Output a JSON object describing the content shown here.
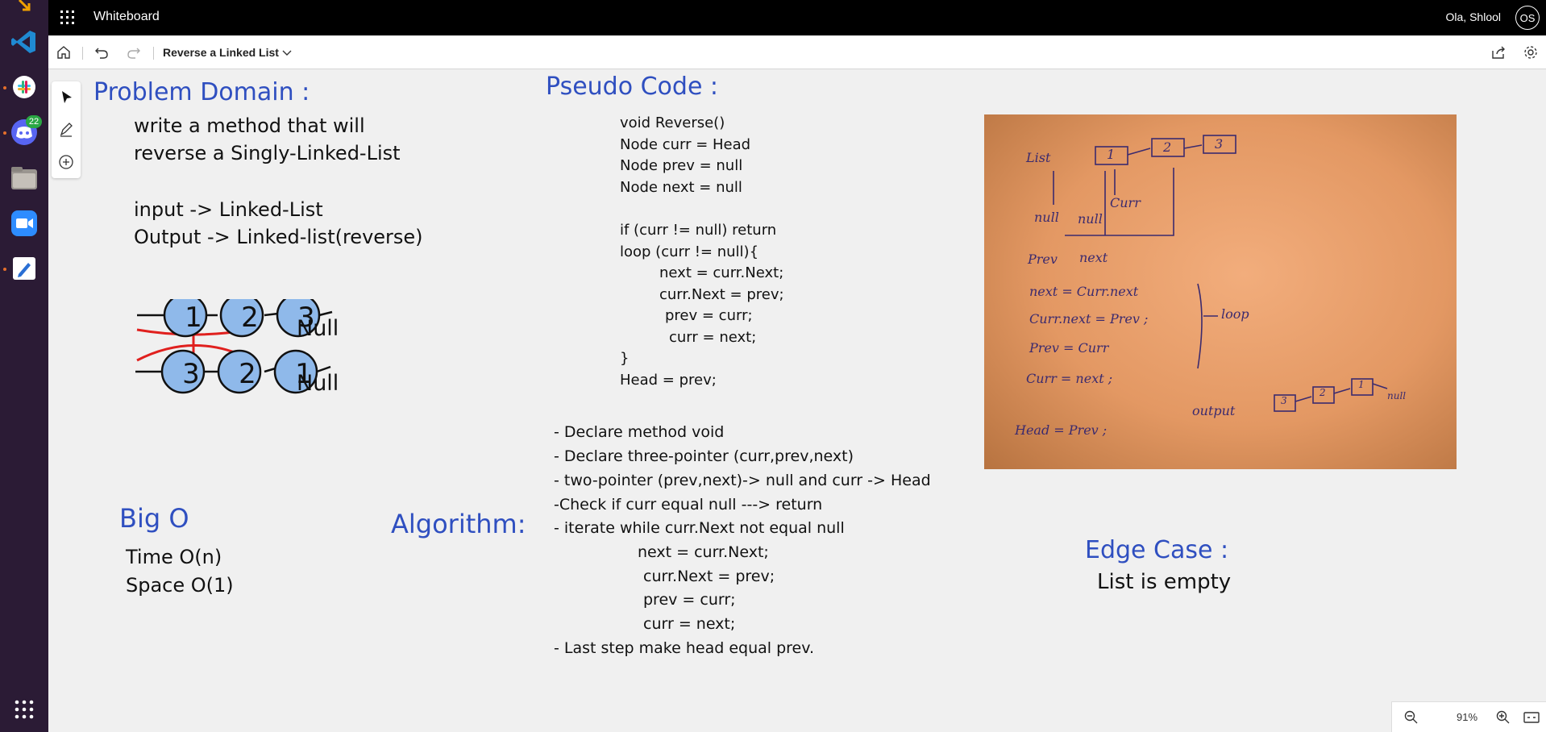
{
  "app": {
    "title": "Whiteboard",
    "user_name": "Ola, Shlool",
    "user_initials": "OS"
  },
  "dock": {
    "discord_badge": "22"
  },
  "toolbar": {
    "board_title": "Reverse a Linked List"
  },
  "zoom": {
    "level": "91%"
  },
  "board": {
    "problem_domain": {
      "heading": "Problem Domain :",
      "lines": [
        "write a method that will",
        "reverse a Singly-Linked-List",
        "input -> Linked-List",
        "Output -> Linked-list(reverse)"
      ]
    },
    "diagram": {
      "top_nodes": [
        "1",
        "2",
        "3"
      ],
      "bottom_nodes": [
        "3",
        "2",
        "1"
      ],
      "null_top": "Null",
      "null_bottom": "Null"
    },
    "pseudo_code": {
      "heading": "Pseudo Code :",
      "lines": [
        "void Reverse()",
        "Node curr = Head",
        "Node prev = null",
        "Node next = null",
        "if (curr != null) return",
        "loop (curr != null){",
        "next = curr.Next;",
        "curr.Next = prev;",
        "prev = curr;",
        "curr = next;",
        "}",
        "Head = prev;"
      ]
    },
    "algorithm": {
      "heading": "Algorithm:",
      "lines": [
        "- Declare method void",
        "- Declare three-pointer (curr,prev,next)",
        "- two-pointer (prev,next)-> null and curr -> Head",
        "-Check if curr equal null ---> return",
        "- iterate while curr.Next not equal null",
        "next = curr.Next;",
        "curr.Next = prev;",
        "prev = curr;",
        "curr = next;",
        "- Last step make head equal prev."
      ]
    },
    "big_o": {
      "heading": "Big O",
      "time": "Time O(n)",
      "space": "Space O(1)"
    },
    "edge_case": {
      "heading": "Edge Case :",
      "text": "List is empty"
    },
    "photo": {
      "list_label": "List",
      "nodes": [
        "1",
        "2",
        "3"
      ],
      "null1": "null",
      "null2": "null",
      "curr": "Curr",
      "prev": "Prev",
      "next": "next",
      "step1": "next = Curr.next",
      "step2": "Curr.next = Prev ;",
      "step3": "Prev = Curr",
      "step4": "Curr = next ;",
      "loop": "loop",
      "output": "output",
      "out_nodes": [
        "3",
        "2",
        "1"
      ],
      "out_null": "null",
      "head_eq": "Head = Prev ;"
    }
  },
  "colors": {
    "heading_blue": "#2f4fc0",
    "node_fill": "#8fb9ea",
    "cross_red": "#e0201e"
  }
}
